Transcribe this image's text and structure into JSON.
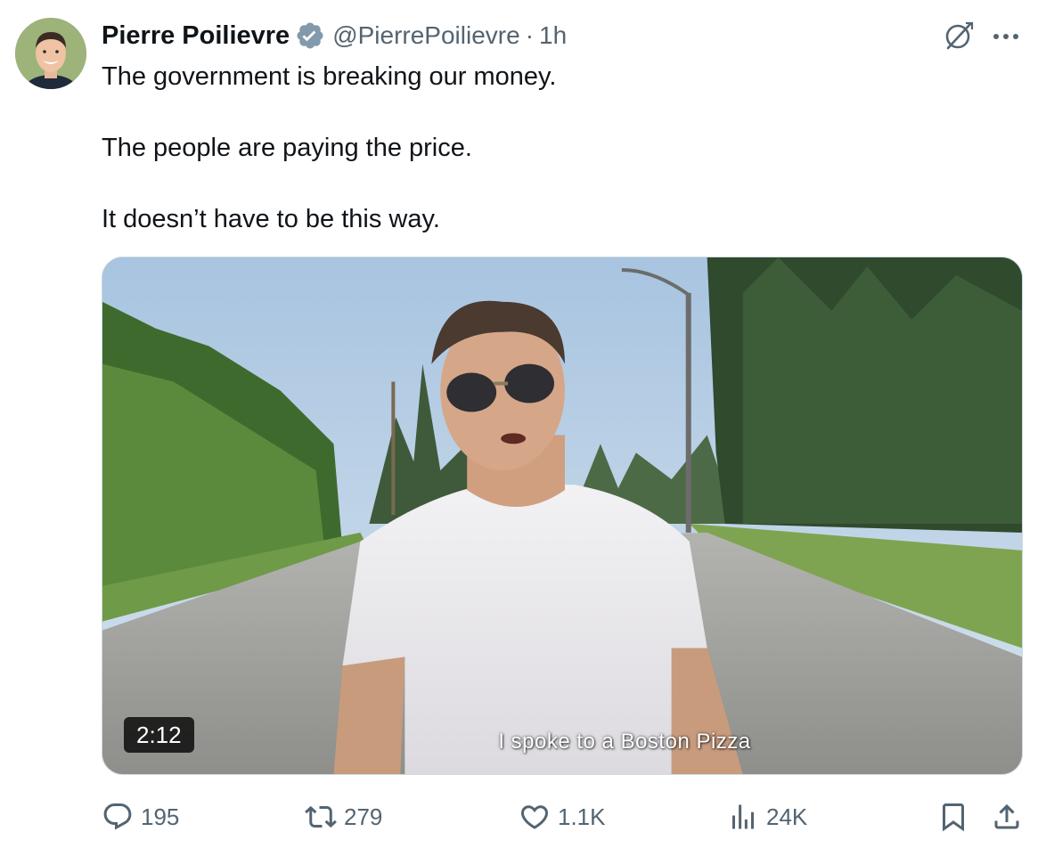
{
  "author": {
    "name": "Pierre Poilievre",
    "handle": "@PierrePoilievre",
    "separator": "·",
    "time": "1h"
  },
  "tweet": {
    "paragraphs": [
      "The government is breaking our money.",
      "The people are paying the price.",
      "It doesn’t have to be this way."
    ]
  },
  "media": {
    "duration": "2:12",
    "caption": "I spoke to a Boston Pizza"
  },
  "actions": {
    "replies": "195",
    "reposts": "279",
    "likes": "1.1K",
    "views": "24K"
  },
  "icons": {
    "verified": "verified-badge-icon",
    "grok": "grok-icon",
    "more": "more-icon",
    "reply": "reply-icon",
    "repost": "repost-icon",
    "like": "heart-icon",
    "views": "views-icon",
    "bookmark": "bookmark-icon",
    "share": "share-icon"
  },
  "colors": {
    "text": "#0f1419",
    "secondary": "#536471",
    "border": "#cfd9de",
    "verified_badge": "#829aab"
  }
}
